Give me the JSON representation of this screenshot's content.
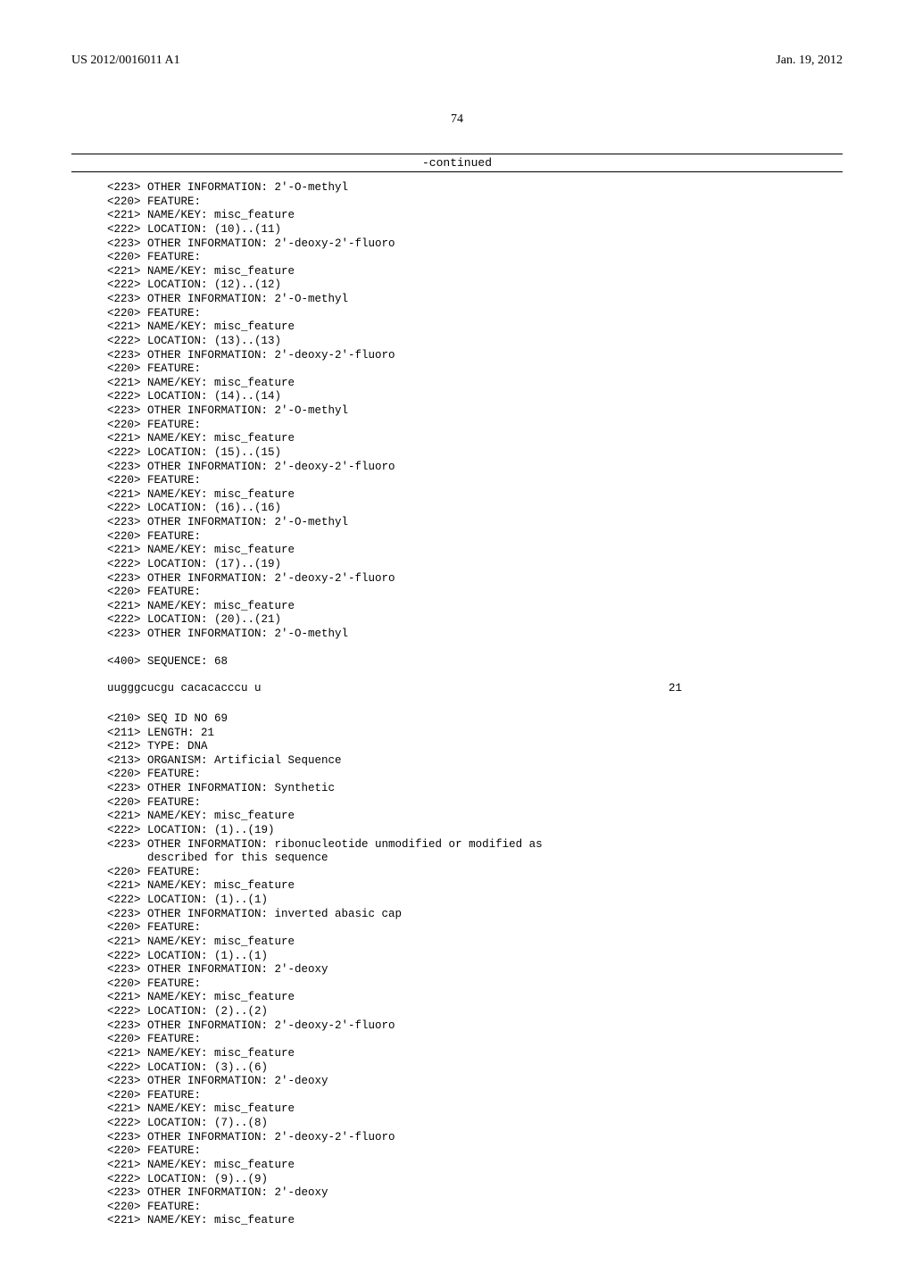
{
  "header": {
    "pub_number": "US 2012/0016011 A1",
    "pub_date": "Jan. 19, 2012"
  },
  "page_number": "74",
  "continued_label": "-continued",
  "listing": [
    "<223> OTHER INFORMATION: 2'-O-methyl",
    "<220> FEATURE:",
    "<221> NAME/KEY: misc_feature",
    "<222> LOCATION: (10)..(11)",
    "<223> OTHER INFORMATION: 2'-deoxy-2'-fluoro",
    "<220> FEATURE:",
    "<221> NAME/KEY: misc_feature",
    "<222> LOCATION: (12)..(12)",
    "<223> OTHER INFORMATION: 2'-O-methyl",
    "<220> FEATURE:",
    "<221> NAME/KEY: misc_feature",
    "<222> LOCATION: (13)..(13)",
    "<223> OTHER INFORMATION: 2'-deoxy-2'-fluoro",
    "<220> FEATURE:",
    "<221> NAME/KEY: misc_feature",
    "<222> LOCATION: (14)..(14)",
    "<223> OTHER INFORMATION: 2'-O-methyl",
    "<220> FEATURE:",
    "<221> NAME/KEY: misc_feature",
    "<222> LOCATION: (15)..(15)",
    "<223> OTHER INFORMATION: 2'-deoxy-2'-fluoro",
    "<220> FEATURE:",
    "<221> NAME/KEY: misc_feature",
    "<222> LOCATION: (16)..(16)",
    "<223> OTHER INFORMATION: 2'-O-methyl",
    "<220> FEATURE:",
    "<221> NAME/KEY: misc_feature",
    "<222> LOCATION: (17)..(19)",
    "<223> OTHER INFORMATION: 2'-deoxy-2'-fluoro",
    "<220> FEATURE:",
    "<221> NAME/KEY: misc_feature",
    "<222> LOCATION: (20)..(21)",
    "<223> OTHER INFORMATION: 2'-O-methyl",
    "",
    "<400> SEQUENCE: 68"
  ],
  "sequence_68": {
    "seq": "uugggcucgu cacacacccu u",
    "len": "21"
  },
  "listing2": [
    "<210> SEQ ID NO 69",
    "<211> LENGTH: 21",
    "<212> TYPE: DNA",
    "<213> ORGANISM: Artificial Sequence",
    "<220> FEATURE:",
    "<223> OTHER INFORMATION: Synthetic",
    "<220> FEATURE:",
    "<221> NAME/KEY: misc_feature",
    "<222> LOCATION: (1)..(19)",
    "<223> OTHER INFORMATION: ribonucleotide unmodified or modified as",
    "      described for this sequence",
    "<220> FEATURE:",
    "<221> NAME/KEY: misc_feature",
    "<222> LOCATION: (1)..(1)",
    "<223> OTHER INFORMATION: inverted abasic cap",
    "<220> FEATURE:",
    "<221> NAME/KEY: misc_feature",
    "<222> LOCATION: (1)..(1)",
    "<223> OTHER INFORMATION: 2'-deoxy",
    "<220> FEATURE:",
    "<221> NAME/KEY: misc_feature",
    "<222> LOCATION: (2)..(2)",
    "<223> OTHER INFORMATION: 2'-deoxy-2'-fluoro",
    "<220> FEATURE:",
    "<221> NAME/KEY: misc_feature",
    "<222> LOCATION: (3)..(6)",
    "<223> OTHER INFORMATION: 2'-deoxy",
    "<220> FEATURE:",
    "<221> NAME/KEY: misc_feature",
    "<222> LOCATION: (7)..(8)",
    "<223> OTHER INFORMATION: 2'-deoxy-2'-fluoro",
    "<220> FEATURE:",
    "<221> NAME/KEY: misc_feature",
    "<222> LOCATION: (9)..(9)",
    "<223> OTHER INFORMATION: 2'-deoxy",
    "<220> FEATURE:",
    "<221> NAME/KEY: misc_feature"
  ]
}
